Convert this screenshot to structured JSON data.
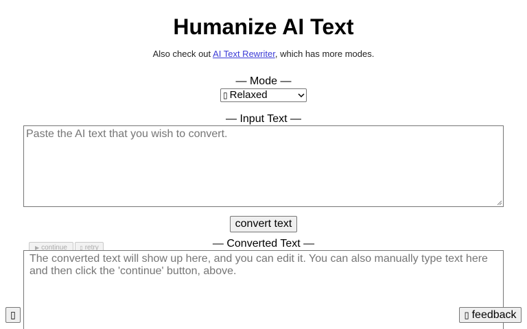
{
  "header": {
    "title": "Humanize AI Text",
    "subtitle_prefix": "Also check out ",
    "subtitle_link": "AI Text Rewriter",
    "subtitle_suffix": ", which has more modes."
  },
  "mode": {
    "label": "— Mode —",
    "selected_glyph": "▯",
    "selected_value": "Relaxed"
  },
  "input": {
    "label": "— Input Text —",
    "placeholder": "Paste the AI text that you wish to convert.",
    "value": ""
  },
  "convert_button": {
    "label": "convert text"
  },
  "output": {
    "label": "— Converted Text —",
    "placeholder": "The converted text will show up here, and you can edit it. You can also manually type text here and then click the 'continue' button, above.",
    "value": "",
    "continue_glyph": "▶",
    "continue_label": "continue",
    "retry_glyph": "▯",
    "retry_label": "retry"
  },
  "footer": {
    "corner_glyph": "▯",
    "feedback_glyph": "▯",
    "feedback_label": "feedback"
  },
  "colors": {
    "link": "#3a3ad6",
    "placeholder": "#757575",
    "button_bg": "#efefef",
    "border": "#767676"
  }
}
